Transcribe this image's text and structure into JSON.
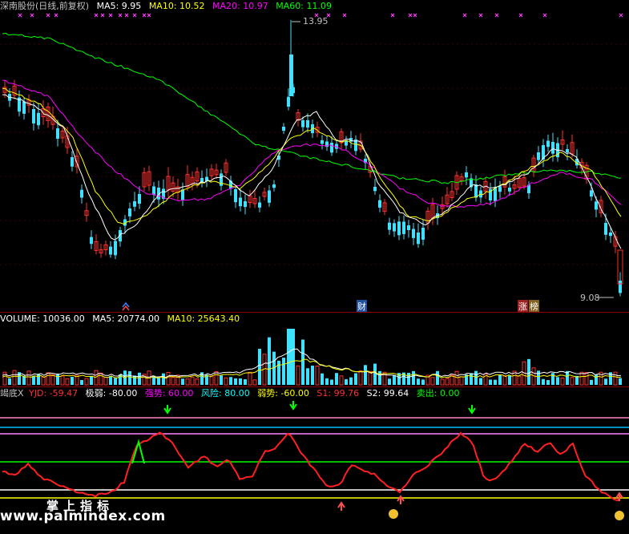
{
  "main": {
    "title": "深南股份(日线,前复权)",
    "ma": [
      {
        "label": "MA5: 9.95",
        "color": "#ffffff"
      },
      {
        "label": "MA10: 10.52",
        "color": "#ffff00"
      },
      {
        "label": "MA20: 10.97",
        "color": "#ff00ff"
      },
      {
        "label": "MA60: 11.09",
        "color": "#00ff00"
      }
    ],
    "high_label": "13.95",
    "low_label": "9.08",
    "tag_cai": "财",
    "tag_zhang": "涨",
    "tag_bang": "榜"
  },
  "volume": {
    "items": [
      {
        "label": "VOLUME: 10036.00",
        "color": "#ffffff"
      },
      {
        "label": "MA5: 20774.00",
        "color": "#ffffff"
      },
      {
        "label": "MA10: 25643.40",
        "color": "#ffff00"
      }
    ]
  },
  "indicator": {
    "items": [
      {
        "label": "竭底X",
        "color": "#c0c0c0"
      },
      {
        "label": "YJD: -59.47",
        "color": "#ff3030"
      },
      {
        "label": "极弱: -80.00",
        "color": "#ffffff"
      },
      {
        "label": "强势: 60.00",
        "color": "#ff00ff"
      },
      {
        "label": "风险: 80.00",
        "color": "#00ffff"
      },
      {
        "label": "弱势: -60.00",
        "color": "#ffff00"
      },
      {
        "label": "S1: 99.76",
        "color": "#ff3030"
      },
      {
        "label": "S2: 99.64",
        "color": "#ffffff"
      },
      {
        "label": "卖出: 0.00",
        "color": "#00ff00"
      }
    ]
  },
  "footer": {
    "tagline": "掌上指标",
    "watermark": "www.palmindex.com"
  },
  "colors": {
    "up": "#ff3030",
    "down": "#40e0ff",
    "ma5": "#ffffff",
    "ma10": "#ffff00",
    "ma20": "#ff00ff",
    "ma60": "#00ff00"
  }
}
